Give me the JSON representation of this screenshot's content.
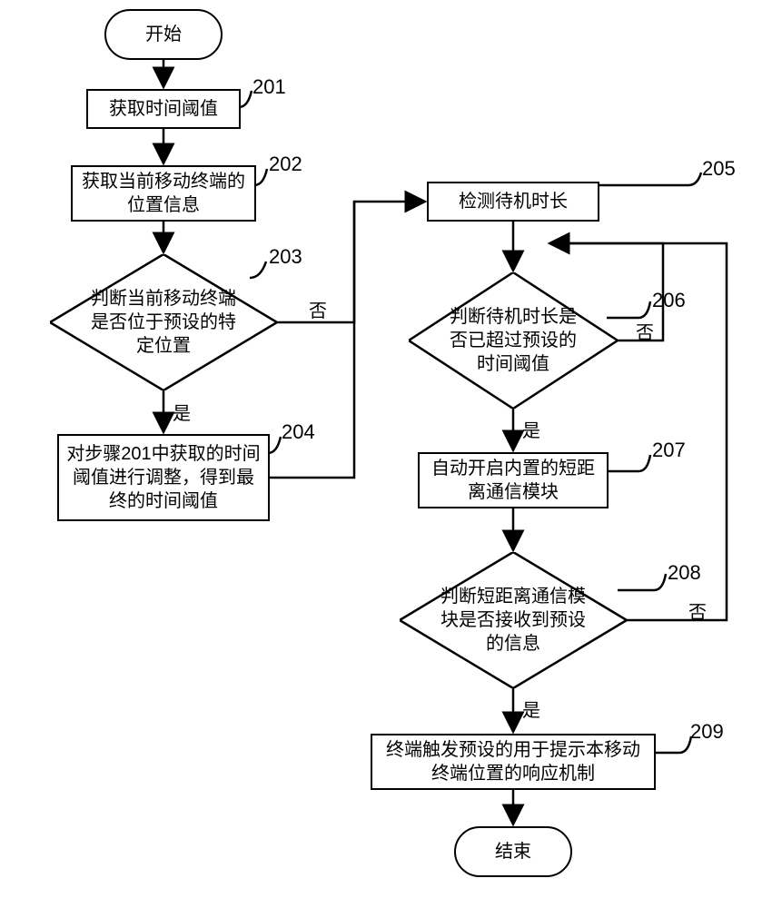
{
  "terminators": {
    "start": "开始",
    "end": "结束"
  },
  "processes": {
    "p201": "获取时间阈值",
    "p202": "获取当前移动终端的位置信息",
    "p204": "对步骤201中获取的时间阈值进行调整，得到最终的时间阈值",
    "p205": "检测待机时长",
    "p207": "自动开启内置的短距离通信模块",
    "p209": "终端触发预设的用于提示本移动终端位置的响应机制"
  },
  "decisions": {
    "d203": "判断当前移动终端是否位于预设的特定位置",
    "d206": "判断待机时长是否已超过预设的时间阈值",
    "d208": "判断短距离通信模块是否接收到预设的信息"
  },
  "refs": {
    "r201": "201",
    "r202": "202",
    "r203": "203",
    "r204": "204",
    "r205": "205",
    "r206": "206",
    "r207": "207",
    "r208": "208",
    "r209": "209"
  },
  "labels": {
    "yes": "是",
    "no": "否"
  },
  "chart_data": {
    "type": "flowchart",
    "nodes": [
      {
        "id": "start",
        "kind": "terminator",
        "label": "开始"
      },
      {
        "id": "201",
        "kind": "process",
        "label": "获取时间阈值"
      },
      {
        "id": "202",
        "kind": "process",
        "label": "获取当前移动终端的位置信息"
      },
      {
        "id": "203",
        "kind": "decision",
        "label": "判断当前移动终端是否位于预设的特定位置"
      },
      {
        "id": "204",
        "kind": "process",
        "label": "对步骤201中获取的时间阈值进行调整，得到最终的时间阈值"
      },
      {
        "id": "205",
        "kind": "process",
        "label": "检测待机时长"
      },
      {
        "id": "206",
        "kind": "decision",
        "label": "判断待机时长是否已超过预设的时间阈值"
      },
      {
        "id": "207",
        "kind": "process",
        "label": "自动开启内置的短距离通信模块"
      },
      {
        "id": "208",
        "kind": "decision",
        "label": "判断短距离通信模块是否接收到预设的信息"
      },
      {
        "id": "209",
        "kind": "process",
        "label": "终端触发预设的用于提示本移动终端位置的响应机制"
      },
      {
        "id": "end",
        "kind": "terminator",
        "label": "结束"
      }
    ],
    "edges": [
      {
        "from": "start",
        "to": "201"
      },
      {
        "from": "201",
        "to": "202"
      },
      {
        "from": "202",
        "to": "203"
      },
      {
        "from": "203",
        "to": "204",
        "label": "是"
      },
      {
        "from": "203",
        "to": "205",
        "label": "否"
      },
      {
        "from": "204",
        "to": "205"
      },
      {
        "from": "205",
        "to": "206"
      },
      {
        "from": "206",
        "to": "207",
        "label": "是"
      },
      {
        "from": "206",
        "to": "205",
        "label": "否"
      },
      {
        "from": "207",
        "to": "208"
      },
      {
        "from": "208",
        "to": "209",
        "label": "是"
      },
      {
        "from": "208",
        "to": "205",
        "label": "否"
      },
      {
        "from": "209",
        "to": "end"
      }
    ]
  }
}
